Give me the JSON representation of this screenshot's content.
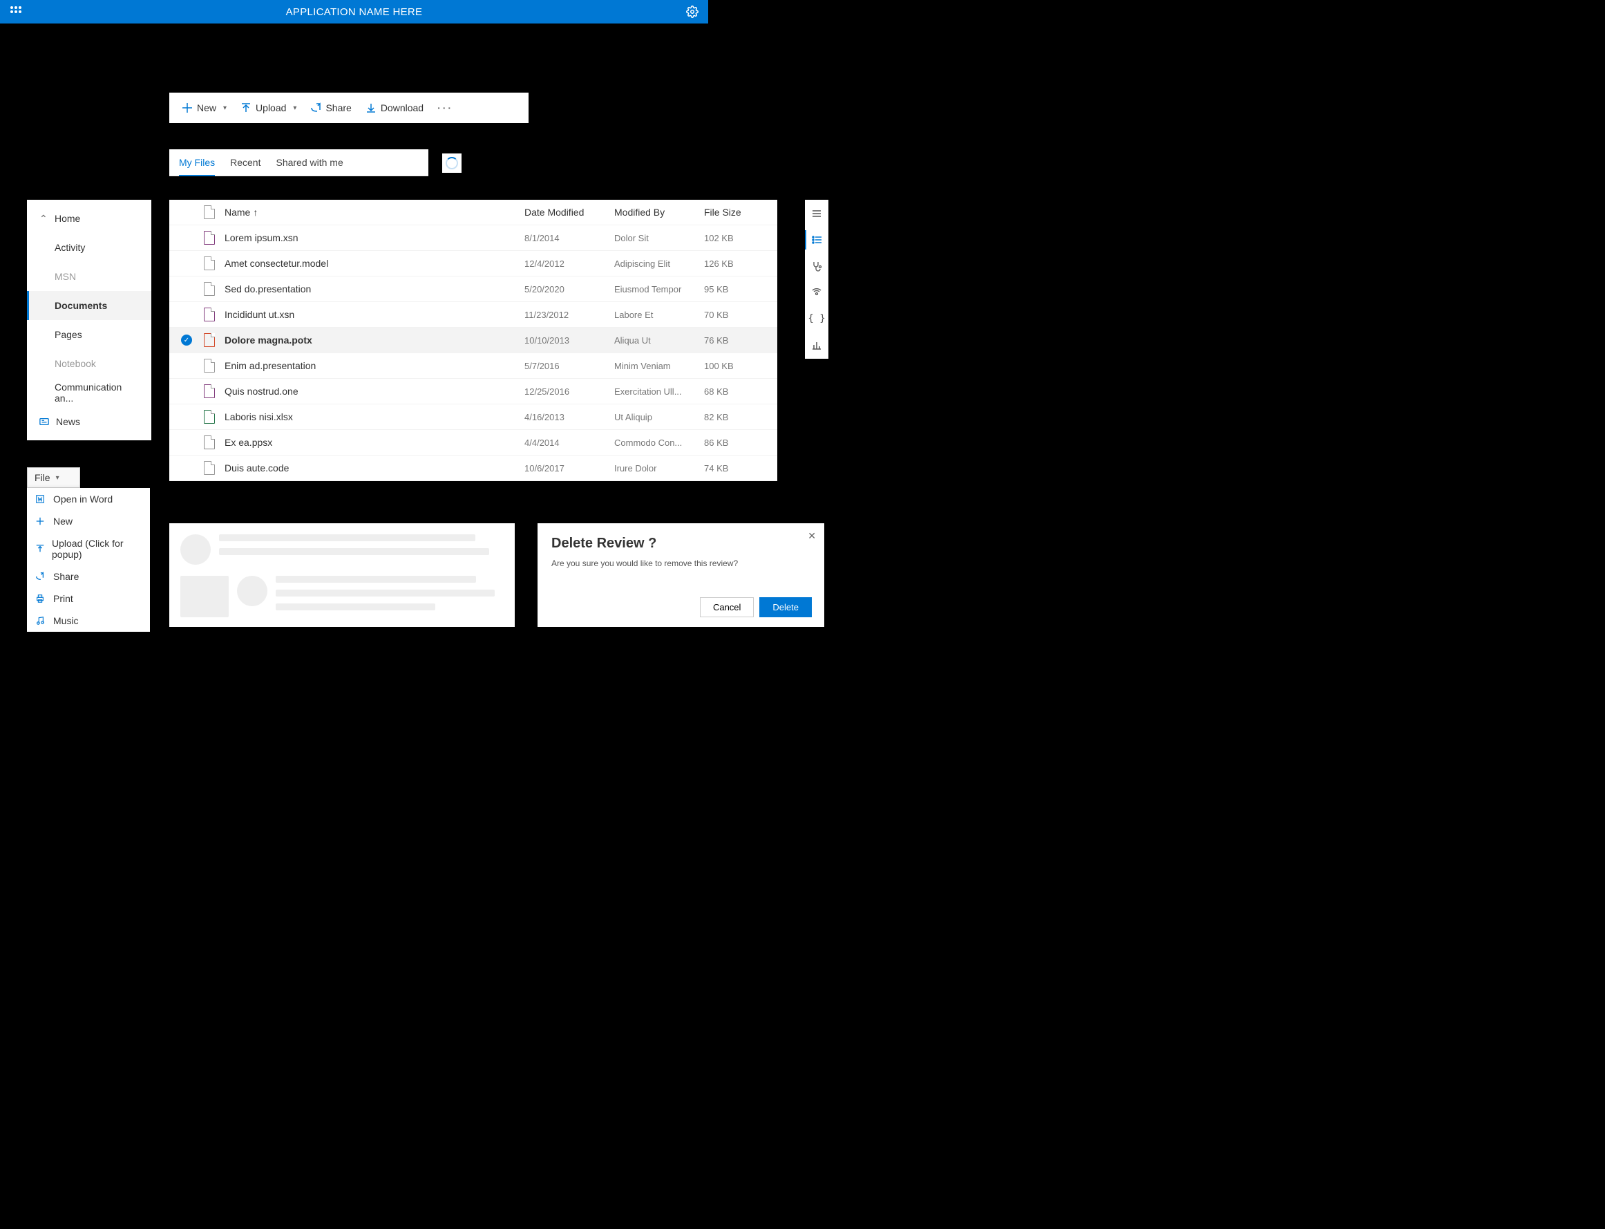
{
  "appbar": {
    "title": "APPLICATION NAME HERE"
  },
  "cmdbar": {
    "new": "New",
    "upload": "Upload",
    "share": "Share",
    "download": "Download"
  },
  "tabs": {
    "myfiles": "My Files",
    "recent": "Recent",
    "shared": "Shared with me"
  },
  "nav": {
    "home": "Home",
    "activity": "Activity",
    "msn": "MSN",
    "documents": "Documents",
    "pages": "Pages",
    "notebook": "Notebook",
    "communication": "Communication an...",
    "news": "News"
  },
  "table": {
    "headers": {
      "name": "Name",
      "sort_arrow": "↑",
      "date": "Date Modified",
      "modby": "Modified By",
      "size": "File Size"
    },
    "rows": [
      {
        "icon": "xsn",
        "name": "Lorem ipsum.xsn",
        "date": "8/1/2014",
        "modby": "Dolor Sit",
        "size": "102 KB",
        "selected": false
      },
      {
        "icon": "plain",
        "name": "Amet consectetur.model",
        "date": "12/4/2012",
        "modby": "Adipiscing Elit",
        "size": "126 KB",
        "selected": false
      },
      {
        "icon": "plain",
        "name": "Sed do.presentation",
        "date": "5/20/2020",
        "modby": "Eiusmod Tempor",
        "size": "95 KB",
        "selected": false
      },
      {
        "icon": "xsn",
        "name": "Incididunt ut.xsn",
        "date": "11/23/2012",
        "modby": "Labore Et",
        "size": "70 KB",
        "selected": false
      },
      {
        "icon": "potx",
        "name": "Dolore magna.potx",
        "date": "10/10/2013",
        "modby": "Aliqua Ut",
        "size": "76 KB",
        "selected": true
      },
      {
        "icon": "plain",
        "name": "Enim ad.presentation",
        "date": "5/7/2016",
        "modby": "Minim Veniam",
        "size": "100 KB",
        "selected": false
      },
      {
        "icon": "one",
        "name": "Quis nostrud.one",
        "date": "12/25/2016",
        "modby": "Exercitation Ull...",
        "size": "68 KB",
        "selected": false
      },
      {
        "icon": "xlsx",
        "name": "Laboris nisi.xlsx",
        "date": "4/16/2013",
        "modby": "Ut Aliquip",
        "size": "82 KB",
        "selected": false
      },
      {
        "icon": "ppsx",
        "name": "Ex ea.ppsx",
        "date": "4/4/2014",
        "modby": "Commodo Con...",
        "size": "86 KB",
        "selected": false
      },
      {
        "icon": "plain",
        "name": "Duis aute.code",
        "date": "10/6/2017",
        "modby": "Irure Dolor",
        "size": "74 KB",
        "selected": false
      }
    ]
  },
  "filemenu": {
    "button": "File",
    "items": {
      "open": "Open in Word",
      "new": "New",
      "upload": "Upload (Click for popup)",
      "share": "Share",
      "print": "Print",
      "music": "Music"
    }
  },
  "dialog": {
    "title": "Delete Review ?",
    "body": "Are you sure you would like to remove this review?",
    "cancel": "Cancel",
    "delete": "Delete"
  }
}
